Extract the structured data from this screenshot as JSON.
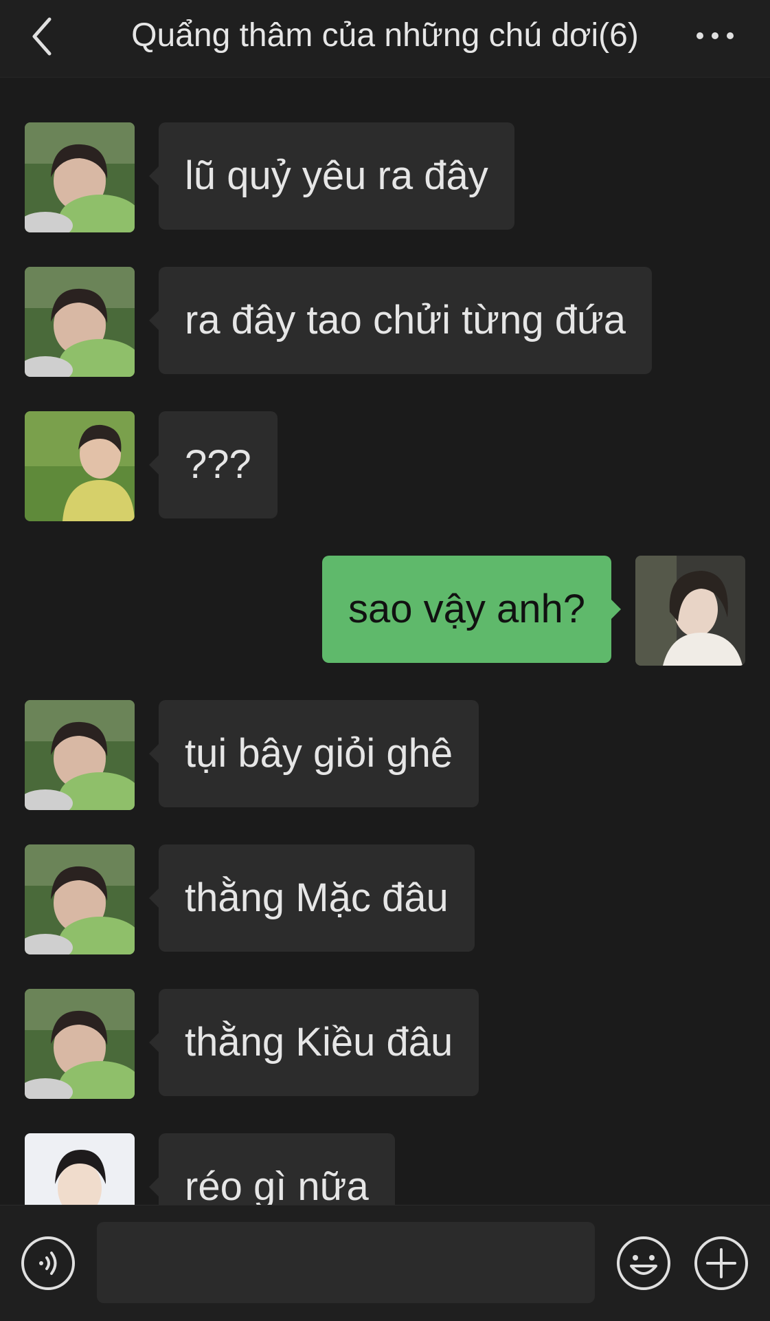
{
  "header": {
    "title": "Quẩng thâm của những chú dơi(6)",
    "back_icon": "chevron-left-icon",
    "more_icon": "more-horizontal-icon"
  },
  "messages": [
    {
      "direction": "incoming",
      "sender": "member-a",
      "text": "lũ quỷ yêu ra đây"
    },
    {
      "direction": "incoming",
      "sender": "member-a",
      "text": "ra đây tao chửi từng đứa"
    },
    {
      "direction": "incoming",
      "sender": "member-b",
      "text": "???"
    },
    {
      "direction": "outgoing",
      "sender": "me",
      "text": "sao vậy anh?"
    },
    {
      "direction": "incoming",
      "sender": "member-a",
      "text": "tụi bây giỏi ghê"
    },
    {
      "direction": "incoming",
      "sender": "member-a",
      "text": "thằng Mặc đâu"
    },
    {
      "direction": "incoming",
      "sender": "member-a",
      "text": "thằng Kiều đâu"
    },
    {
      "direction": "incoming",
      "sender": "member-c",
      "text": "réo gì nữa"
    }
  ],
  "input_bar": {
    "voice_icon": "voice-icon",
    "input_value": "",
    "emoji_icon": "emoji-icon",
    "plus_icon": "plus-circle-icon"
  },
  "colors": {
    "background": "#1b1b1b",
    "incoming_bubble": "#2c2c2c",
    "outgoing_bubble": "#5fb96b",
    "text": "#e6e6e6"
  }
}
